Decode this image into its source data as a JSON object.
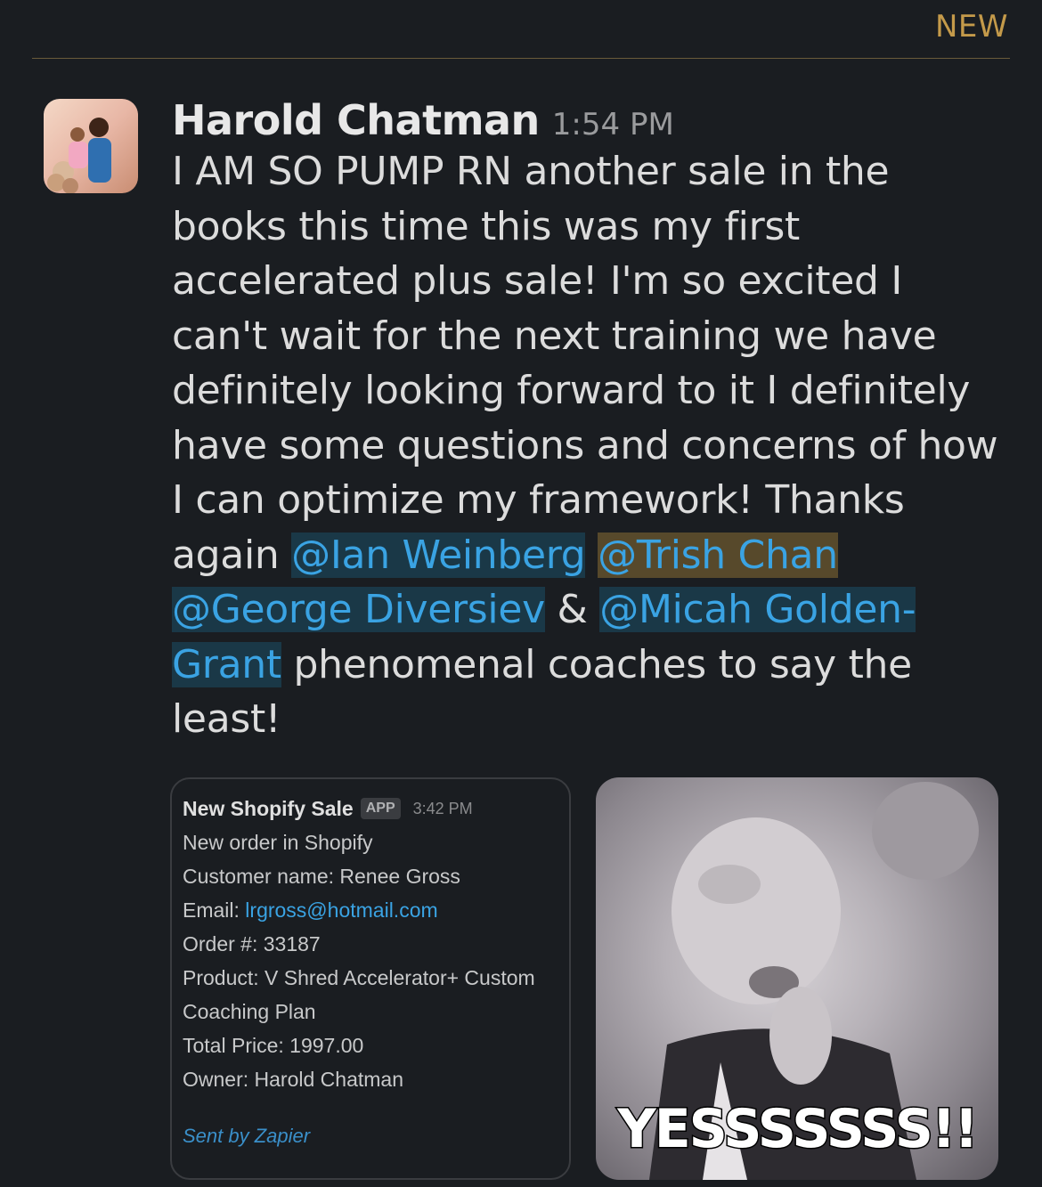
{
  "header": {
    "new_label": "NEW"
  },
  "message": {
    "sender": "Harold Chatman",
    "time": "1:54 PM",
    "text_before": "I AM SO PUMP RN another sale in the books this time this was my first accelerated plus sale! I'm so excited I can't wait for the next training we have definitely looking forward to it I definitely have some questions and concerns of how I can optimize my framework! Thanks again ",
    "mentions": [
      "@Ian Weinberg",
      "@Trish Chan",
      "@George Diversiev",
      "@Micah Golden-Grant"
    ],
    "amp": " & ",
    "text_after": " phenomenal coaches to say the least!"
  },
  "card": {
    "title": "New Shopify Sale",
    "app_badge": "APP",
    "time": "3:42 PM",
    "line1": "New order in Shopify",
    "customer": "Customer name: Renee Gross",
    "email_label": "Email: ",
    "email": "lrgross@hotmail.com",
    "order": "Order #: 33187",
    "product": "Product: V Shred Accelerator+ Custom Coaching Plan",
    "total": "Total Price: 1997.00",
    "owner": "Owner: Harold Chatman",
    "footer": "Sent by Zapier"
  },
  "gif": {
    "caption": "YESSSSSSS!!"
  },
  "colors": {
    "background": "#1a1d21",
    "mention": "#3aa3e3",
    "new_label": "#c49a4a"
  }
}
